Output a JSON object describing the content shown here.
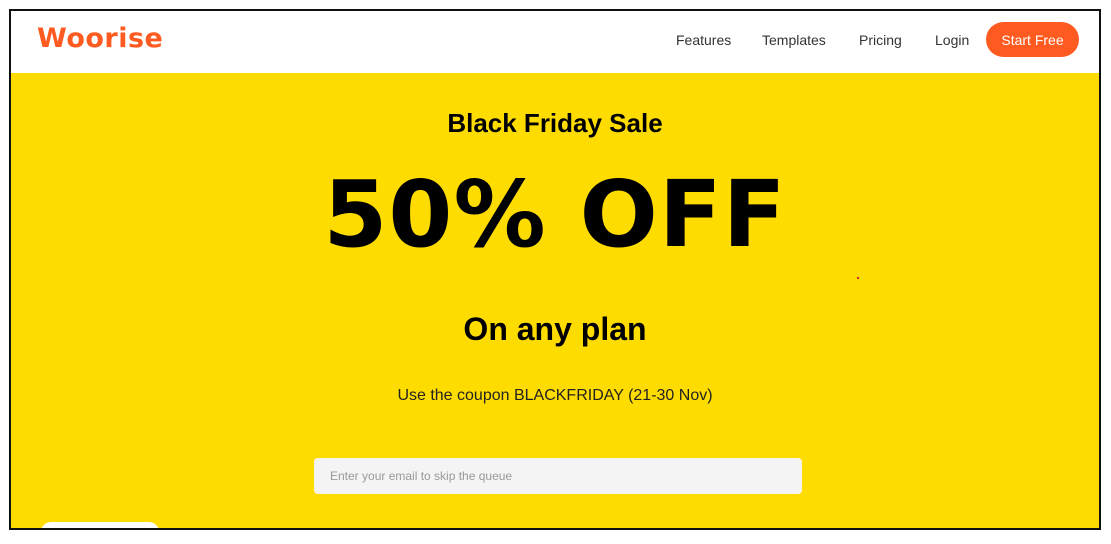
{
  "brand": {
    "logo_text": "Woorise",
    "accent_color": "#ff5a1f"
  },
  "nav": {
    "items": [
      "Features",
      "Templates",
      "Pricing",
      "Login"
    ],
    "cta_label": "Start Free"
  },
  "hero": {
    "background_color": "#ffdc00",
    "subtitle": "Black Friday Sale",
    "discount": "50% OFF",
    "plan_text": "On any plan",
    "coupon_text": "Use the coupon BLACKFRIDAY (21-30 Nov)",
    "email_placeholder": "Enter your email to skip the queue"
  }
}
